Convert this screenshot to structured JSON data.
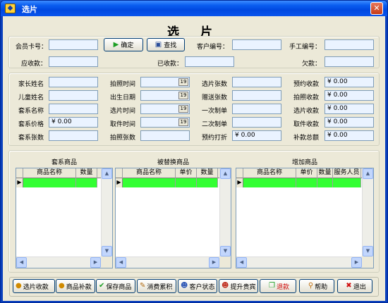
{
  "window": {
    "title": "选片",
    "close": "✕",
    "app_icon": "app-icon"
  },
  "heading": "选 片",
  "top": {
    "member_card_label": "会员卡号：",
    "member_card_value": "",
    "confirm_label": "确定",
    "search_label": "查找",
    "customer_no_label": "客户编号：",
    "customer_no_value": "",
    "manual_no_label": "手工编号：",
    "manual_no_value": "",
    "receivable_label": "应收款：",
    "receivable_value": "",
    "received_label": "已收款：",
    "received_value": "",
    "owed_label": "欠款：",
    "owed_value": ""
  },
  "fields": {
    "parent_name_label": "家长姓名",
    "parent_name_value": "",
    "child_name_label": "儿童姓名",
    "child_name_value": "",
    "package_name_label": "套系名称",
    "package_name_value": "",
    "package_price_label": "套系价格",
    "package_price_value": "¥ 0.00",
    "package_count_label": "套系张数",
    "package_count_value": "",
    "shoot_time_label": "拍照时间",
    "shoot_time_value": "",
    "birth_date_label": "出生日期",
    "birth_date_value": "",
    "select_time_label": "选片时间",
    "select_time_value": "",
    "pickup_time_label": "取件时间",
    "pickup_time_value": "",
    "shoot_count_label": "拍照张数",
    "shoot_count_value": "",
    "selected_count_label": "选片张数",
    "selected_count_value": "",
    "gift_count_label": "赠送张数",
    "gift_count_value": "",
    "first_sheet_label": "一次制单",
    "first_sheet_value": "",
    "second_sheet_label": "二次制单",
    "second_sheet_value": "",
    "booking_discount_label": "预约打折",
    "booking_discount_value": "¥ 0.00",
    "booking_receipt_label": "预约收款",
    "booking_receipt_value": "¥ 0.00",
    "shoot_receipt_label": "拍照收款",
    "shoot_receipt_value": "¥ 0.00",
    "select_receipt_label": "选片收款",
    "select_receipt_value": "¥ 0.00",
    "pickup_receipt_label": "取件收款",
    "pickup_receipt_value": "¥ 0.00",
    "extra_total_label": "补款总额",
    "extra_total_value": "¥ 0.00",
    "date_button_glyph": "19"
  },
  "grids": {
    "package": {
      "title": "套系商品",
      "columns": [
        "商品名称",
        "数量"
      ]
    },
    "replaced": {
      "title": "被替换商品",
      "columns": [
        "商品名称",
        "单价",
        "数量"
      ]
    },
    "added": {
      "title": "增加商品",
      "columns": [
        "商品名称",
        "单价",
        "数量",
        "服务人员"
      ]
    },
    "row_indicator": "▶",
    "scroll_up": "▲",
    "scroll_down": "▼",
    "scroll_left": "◀",
    "scroll_right": "▶"
  },
  "buttons": {
    "select_payment": {
      "label": "选片收款",
      "icon": "coins-icon"
    },
    "goods_extra": {
      "label": "商品补款",
      "icon": "coins-icon"
    },
    "save_goods": {
      "label": "保存商品",
      "icon": "checkmark-icon"
    },
    "consume_accumulate": {
      "label": "消费累积",
      "icon": "pencil-icon"
    },
    "customer_status": {
      "label": "客户状态",
      "icon": "person-icon"
    },
    "upgrade_vip": {
      "label": "提升贵宾",
      "icon": "person-icon"
    },
    "refund": {
      "label": "退款",
      "icon": "copy-icon"
    },
    "help": {
      "label": "帮助",
      "icon": "magnifier-icon"
    },
    "exit": {
      "label": "退出",
      "icon": "red-x-icon"
    }
  }
}
